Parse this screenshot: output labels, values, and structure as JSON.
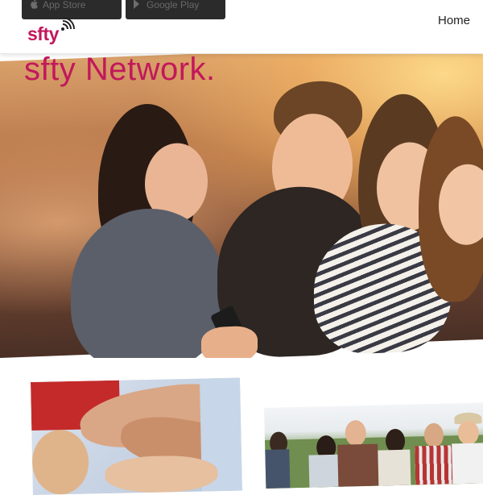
{
  "header": {
    "app_store_label": "App Store",
    "google_play_label": "Google Play",
    "logo_text": "sfty",
    "nav": {
      "home_label": "Home"
    }
  },
  "hero": {
    "title": "sfty Network."
  },
  "colors": {
    "brand": "#c2185b",
    "header_bg": "#ffffff",
    "badge_bg": "#2b2b2b",
    "nav_text": "#222222"
  },
  "icons": [
    "apple-icon",
    "google-play-icon",
    "signal-wave-icon"
  ]
}
